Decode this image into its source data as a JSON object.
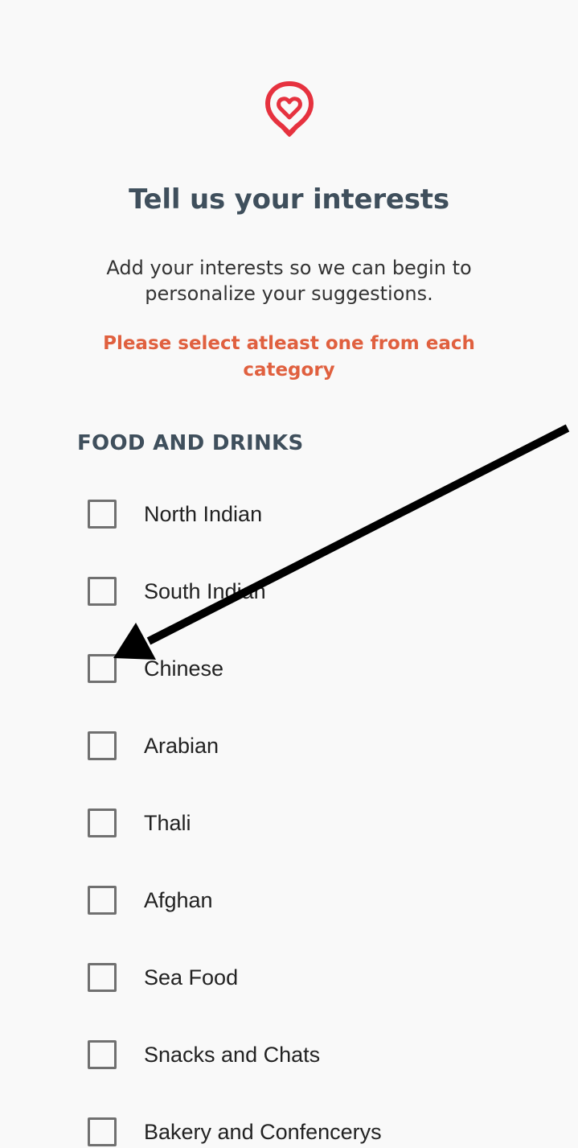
{
  "brand": {
    "logo_icon": "heart-location-pin-icon",
    "accent_color": "#e6323f"
  },
  "header": {
    "title": "Tell us your interests",
    "subtitle": "Add your interests so we can begin to personalize your suggestions.",
    "warning": "Please select atleast one from each category",
    "warning_color": "#e0603f"
  },
  "section": {
    "heading": "FOOD AND DRINKS",
    "options": [
      {
        "label": "North Indian",
        "checked": false
      },
      {
        "label": "South Indian",
        "checked": false
      },
      {
        "label": "Chinese",
        "checked": false
      },
      {
        "label": "Arabian",
        "checked": false
      },
      {
        "label": "Thali",
        "checked": false
      },
      {
        "label": "Afghan",
        "checked": false
      },
      {
        "label": "Sea Food",
        "checked": false
      },
      {
        "label": "Snacks and Chats",
        "checked": false
      },
      {
        "label": "Bakery and Confencerys",
        "checked": false
      }
    ]
  },
  "annotation": {
    "arrow_icon": "pointer-arrow-icon",
    "arrow_color": "#000000"
  }
}
